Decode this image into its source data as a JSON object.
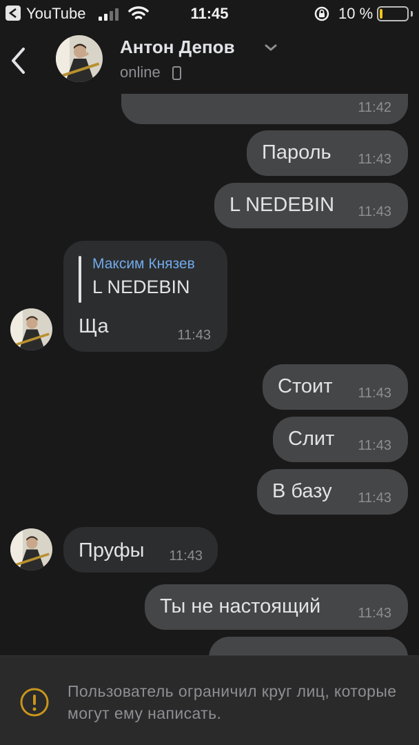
{
  "status_bar": {
    "back_app": "YouTube",
    "time": "11:45",
    "battery_percent": "10 %",
    "battery_level": 0.1,
    "icons": [
      "signal-icon",
      "wifi-icon",
      "rotation-lock-icon",
      "battery-icon"
    ]
  },
  "header": {
    "name": "Антон Депов",
    "status": "online",
    "icons": [
      "back-icon",
      "chevron-down-icon",
      "mobile-phone-icon"
    ]
  },
  "messages": [
    {
      "direction": "out",
      "text": "",
      "time": "11:42"
    },
    {
      "direction": "out",
      "text": "Пароль",
      "time": "11:43"
    },
    {
      "direction": "out",
      "text": "L NEDEBIN",
      "time": "11:43"
    },
    {
      "direction": "in",
      "reply_author": "Максим Князев",
      "reply_text": "L NEDEBIN",
      "text": "Ща",
      "time": "11:43"
    },
    {
      "direction": "out",
      "text": "Стоит",
      "time": "11:43"
    },
    {
      "direction": "out",
      "text": "Слит",
      "time": "11:43"
    },
    {
      "direction": "out",
      "text": "В базу",
      "time": "11:43"
    },
    {
      "direction": "in",
      "text": "Пруфы",
      "time": "11:43"
    },
    {
      "direction": "out",
      "text": "Ты не настоящий",
      "time": "11:43"
    }
  ],
  "footer": {
    "notice": "Пользователь ограничил круг лиц, которые могут ему написать.",
    "icon": "warning-icon"
  },
  "colors": {
    "background": "#19191a",
    "bubble_out": "#454647",
    "bubble_in": "#2c2d2e",
    "accent_link": "#71aaeb",
    "warning": "#c9961a",
    "battery_low": "#f5c518"
  }
}
